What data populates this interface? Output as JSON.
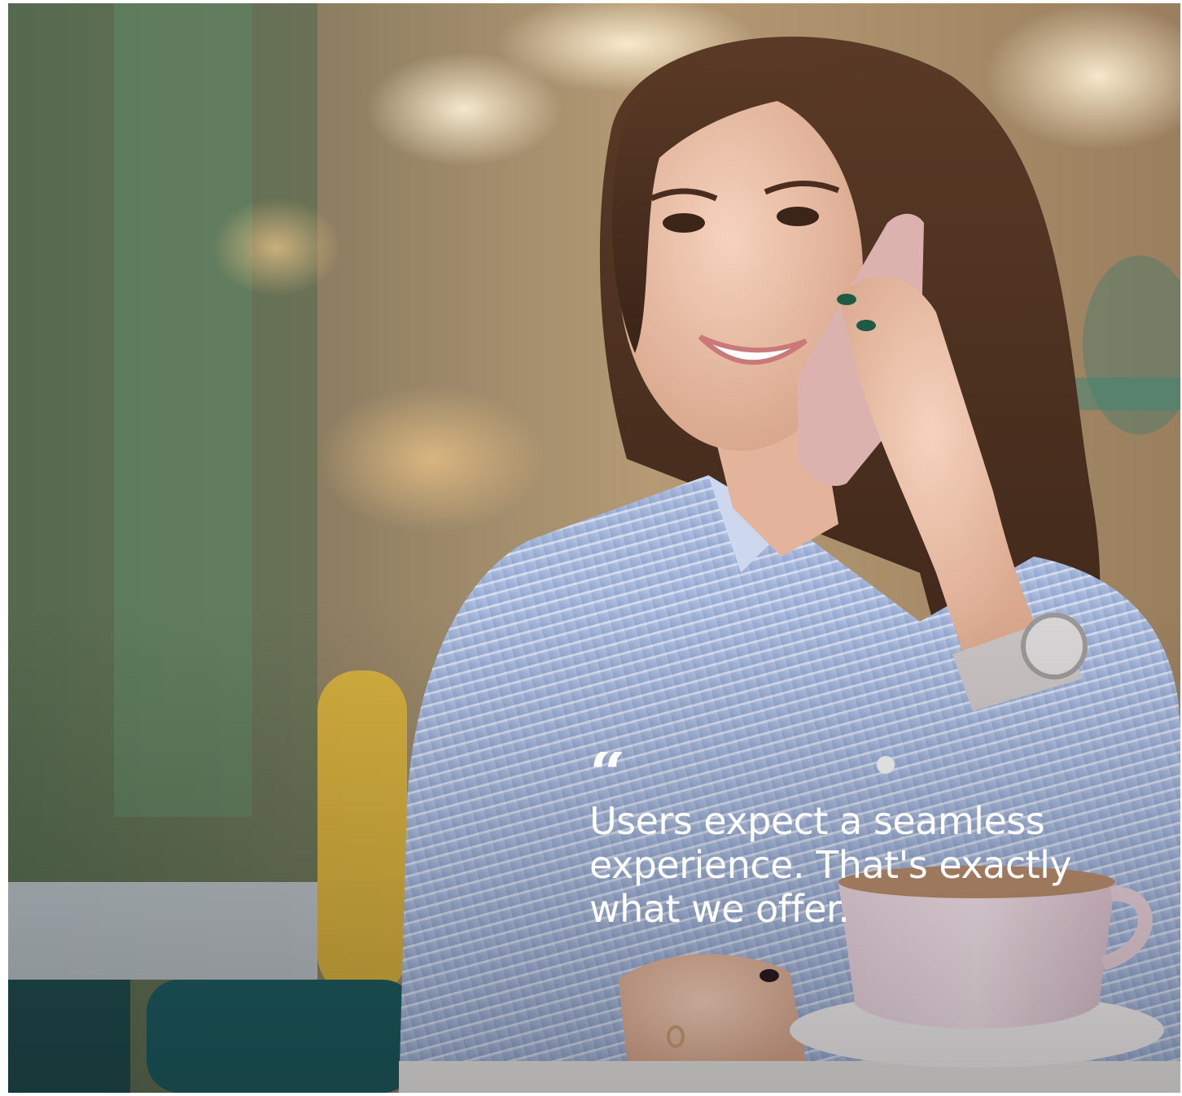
{
  "photo": {
    "description_icon": "woman-on-phone-photo"
  },
  "quote": {
    "mark": "“",
    "text": "Users expect a seamless experience. That's exactly what we offer."
  }
}
